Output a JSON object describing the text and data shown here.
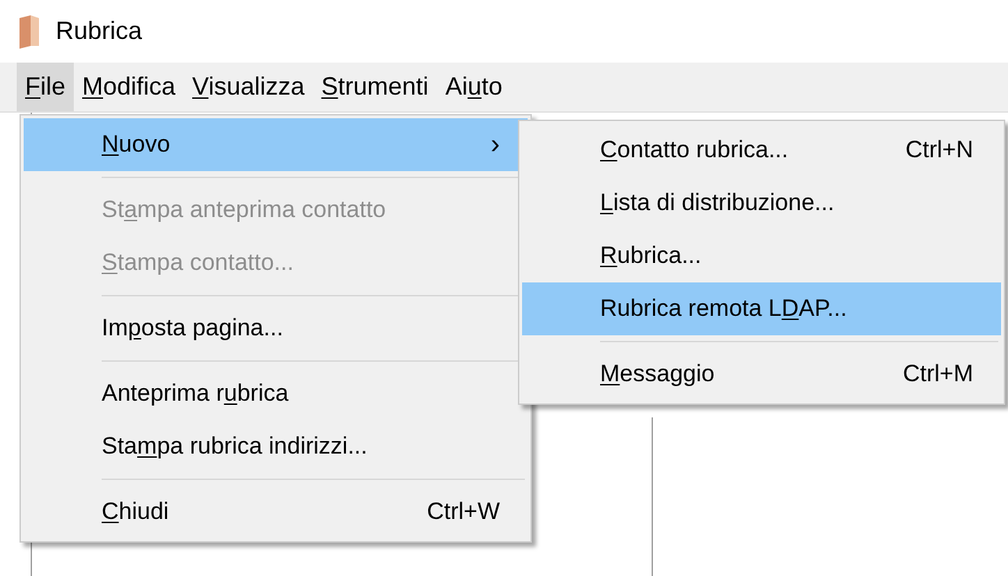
{
  "window": {
    "title": "Rubrica"
  },
  "menubar": [
    {
      "label": {
        "key": "F",
        "after": "ile"
      },
      "selected": true
    },
    {
      "label": {
        "key": "M",
        "after": "odifica"
      },
      "selected": false
    },
    {
      "label": {
        "key": "V",
        "after": "isualizza"
      },
      "selected": false
    },
    {
      "label": {
        "key": "S",
        "after": "trumenti"
      },
      "selected": false
    },
    {
      "label": {
        "before": "Ai",
        "key": "u",
        "after": "to"
      },
      "selected": false
    }
  ],
  "file_menu": [
    {
      "kind": "item",
      "label": {
        "key": "N",
        "after": "uovo"
      },
      "submenu_arrow": "›",
      "selected": true,
      "disabled": false
    },
    {
      "kind": "separator"
    },
    {
      "kind": "item",
      "label": {
        "before": "St",
        "key": "a",
        "after": "mpa anteprima contatto"
      },
      "selected": false,
      "disabled": true
    },
    {
      "kind": "item",
      "label": {
        "key": "S",
        "after": "tampa contatto..."
      },
      "selected": false,
      "disabled": true
    },
    {
      "kind": "separator"
    },
    {
      "kind": "item",
      "label": {
        "before": "Im",
        "key": "p",
        "after": "osta pagina..."
      },
      "selected": false,
      "disabled": false
    },
    {
      "kind": "separator"
    },
    {
      "kind": "item",
      "label": {
        "before": "Anteprima r",
        "key": "u",
        "after": "brica"
      },
      "selected": false,
      "disabled": false
    },
    {
      "kind": "item",
      "label": {
        "before": "Sta",
        "key": "m",
        "after": "pa rubrica indirizzi..."
      },
      "selected": false,
      "disabled": false
    },
    {
      "kind": "separator"
    },
    {
      "kind": "item",
      "label": {
        "key": "C",
        "after": "hiudi"
      },
      "shortcut": "Ctrl+W",
      "selected": false,
      "disabled": false
    }
  ],
  "new_submenu": [
    {
      "kind": "item",
      "label": {
        "key": "C",
        "after": "ontatto rubrica..."
      },
      "shortcut": "Ctrl+N",
      "selected": false,
      "disabled": false
    },
    {
      "kind": "item",
      "label": {
        "key": "L",
        "after": "ista di distribuzione..."
      },
      "selected": false,
      "disabled": false
    },
    {
      "kind": "item",
      "label": {
        "key": "R",
        "after": "ubrica..."
      },
      "selected": false,
      "disabled": false
    },
    {
      "kind": "item",
      "label": {
        "before": "Rubrica remota L",
        "key": "D",
        "after": "AP..."
      },
      "selected": true,
      "disabled": false
    },
    {
      "kind": "separator"
    },
    {
      "kind": "item",
      "label": {
        "key": "M",
        "after": "essaggio"
      },
      "shortcut": "Ctrl+M",
      "selected": false,
      "disabled": false
    }
  ]
}
